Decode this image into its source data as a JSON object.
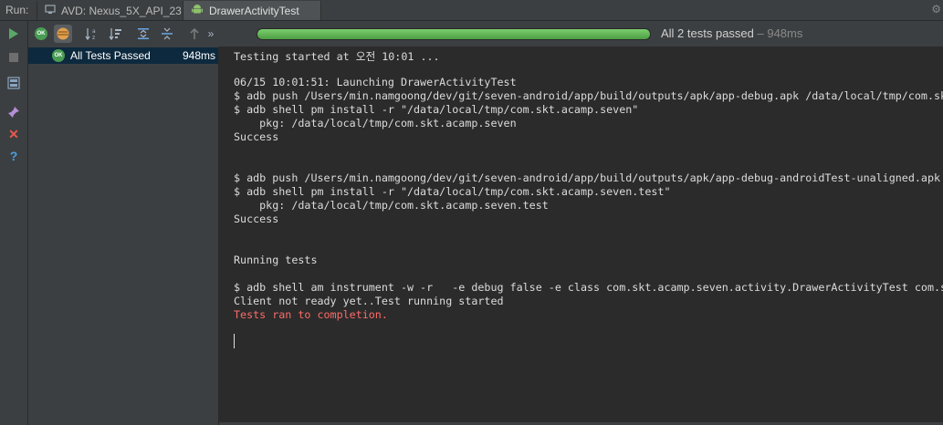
{
  "tabbar": {
    "run_label": "Run:",
    "tabs": [
      {
        "label": "AVD: Nexus_5X_API_23",
        "icon": "device-icon"
      },
      {
        "label": "DrawerActivityTest",
        "icon": "android-icon"
      }
    ]
  },
  "toolbar": {
    "progress_fraction": 1.0,
    "status_text": "All 2 tests passed",
    "duration_text": " – 948ms",
    "ok_badge": "OK"
  },
  "tree": {
    "root_label": "All Tests Passed",
    "root_time": "948ms",
    "badge": "OK"
  },
  "console": {
    "lines": [
      "Testing started at 오전 10:01 ...",
      "",
      "06/15 10:01:51: Launching DrawerActivityTest",
      "$ adb push /Users/min.namgoong/dev/git/seven-android/app/build/outputs/apk/app-debug.apk /data/local/tmp/com.sk",
      "$ adb shell pm install -r \"/data/local/tmp/com.skt.acamp.seven\"",
      "    pkg: /data/local/tmp/com.skt.acamp.seven",
      "Success",
      "",
      "",
      "$ adb push /Users/min.namgoong/dev/git/seven-android/app/build/outputs/apk/app-debug-androidTest-unaligned.apk",
      "$ adb shell pm install -r \"/data/local/tmp/com.skt.acamp.seven.test\"",
      "    pkg: /data/local/tmp/com.skt.acamp.seven.test",
      "Success",
      "",
      "",
      "Running tests",
      "",
      "$ adb shell am instrument -w -r   -e debug false -e class com.skt.acamp.seven.activity.DrawerActivityTest com.s",
      "Client not ready yet..Test running started",
      "Tests ran to completion."
    ]
  },
  "colors": {
    "success_green": "#499c54",
    "error_red": "#ff6b68",
    "selection_blue": "#0d293e"
  }
}
